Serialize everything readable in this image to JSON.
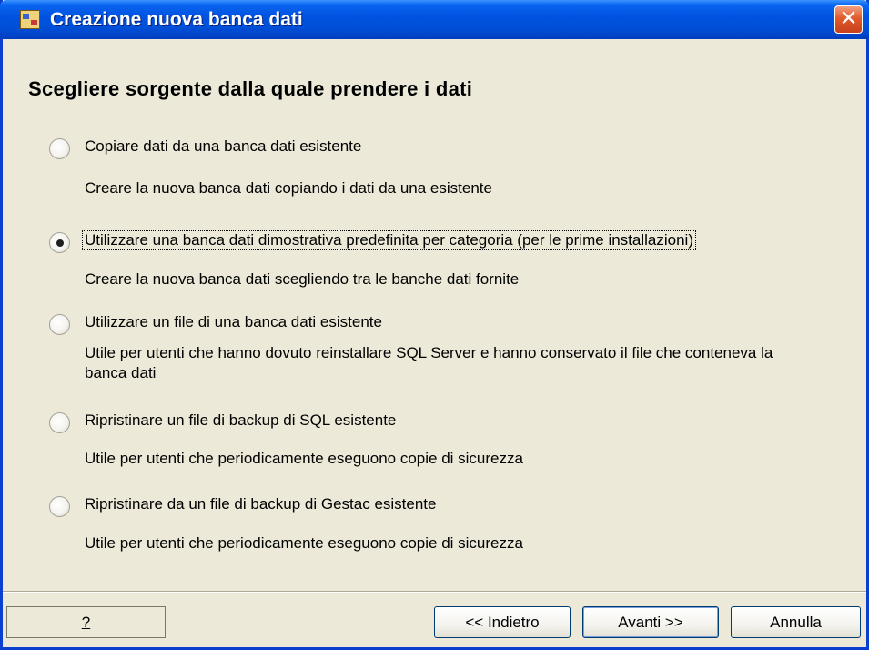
{
  "window": {
    "title": "Creazione nuova banca dati",
    "close_glyph": "✕"
  },
  "heading": "Scegliere sorgente dalla quale prendere i dati",
  "options": [
    {
      "label": "Copiare dati da una banca dati esistente",
      "description": "Creare la nuova banca dati copiando i dati da una esistente",
      "selected": false
    },
    {
      "label": "Utilizzare una banca dati dimostrativa predefinita per categoria (per le prime installazioni)",
      "description": "Creare la nuova banca dati scegliendo tra le banche dati fornite",
      "selected": true
    },
    {
      "label": "Utilizzare un file di una banca dati esistente",
      "description": "Utile per utenti che hanno dovuto reinstallare SQL Server e hanno conservato il file che conteneva la banca dati",
      "selected": false
    },
    {
      "label": "Ripristinare un file di backup di SQL esistente",
      "description": "Utile per utenti che periodicamente eseguono copie di sicurezza",
      "selected": false
    },
    {
      "label": "Ripristinare da un file di backup di Gestac esistente",
      "description": "Utile per utenti che periodicamente eseguono copie di sicurezza",
      "selected": false
    }
  ],
  "buttons": {
    "help": "?",
    "back": "<< Indietro",
    "next": "Avanti >>",
    "cancel": "Annulla"
  },
  "colors": {
    "titlebar": "#0053e1",
    "background": "#ece9d8",
    "close": "#e05a2a"
  }
}
